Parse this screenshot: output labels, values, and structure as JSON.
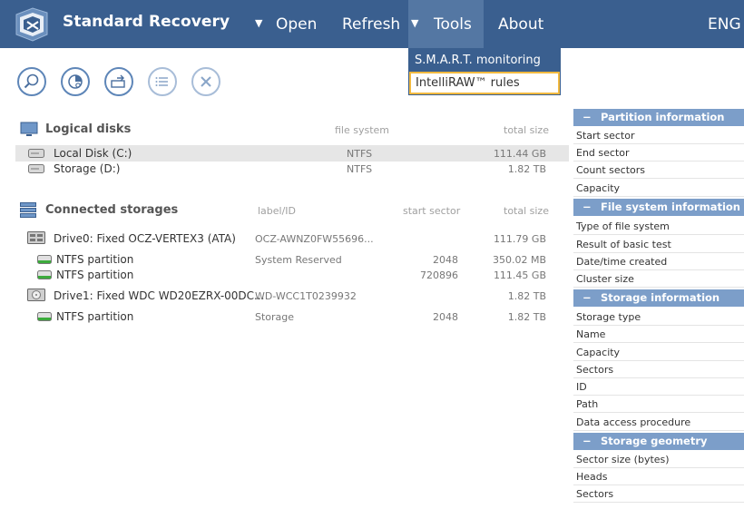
{
  "header": {
    "title": "Standard Recovery",
    "menu": {
      "open": "Open",
      "refresh": "Refresh",
      "tools": "Tools",
      "about": "About",
      "lang": "ENG"
    },
    "arrow_glyph": "▼"
  },
  "tools_menu": {
    "items": [
      "S.M.A.R.T. monitoring",
      "IntelliRAW™ rules"
    ]
  },
  "toolbar": {
    "icons": [
      "search-icon",
      "scan-icon",
      "transfer-icon",
      "list-icon",
      "close-icon"
    ]
  },
  "logical_disks": {
    "title": "Logical disks",
    "col_fs": "file system",
    "col_size": "total size",
    "rows": [
      {
        "name": "Local Disk (C:)",
        "fs": "NTFS",
        "size": "111.44 GB"
      },
      {
        "name": "Storage (D:)",
        "fs": "NTFS",
        "size": "1.82 TB"
      }
    ]
  },
  "connected_storages": {
    "title": "Connected storages",
    "col_label": "label/ID",
    "col_start": "start sector",
    "col_size": "total size",
    "drives": [
      {
        "name": "Drive0: Fixed OCZ-VERTEX3 (ATA)",
        "label": "OCZ-AWNZ0FW55696...",
        "start": "",
        "size": "111.79 GB"
      },
      {
        "name": "Drive1: Fixed WDC WD20EZRX-00DC...",
        "label": "WD-WCC1T0239932",
        "start": "",
        "size": "1.82 TB"
      }
    ],
    "partitions": [
      {
        "name": "NTFS partition",
        "label": "System Reserved",
        "start": "2048",
        "size": "350.02 MB"
      },
      {
        "name": "NTFS partition",
        "label": "",
        "start": "720896",
        "size": "111.45 GB"
      },
      {
        "name": "NTFS partition",
        "label": "Storage",
        "start": "2048",
        "size": "1.82 TB"
      }
    ]
  },
  "right_panel": {
    "dash": "−",
    "partition_info": {
      "title": "Partition information",
      "fields": [
        "Start sector",
        "End sector",
        "Count sectors",
        "Capacity"
      ]
    },
    "fs_info": {
      "title": "File system information",
      "fields": [
        "Type of file system",
        "Result of basic test",
        "Date/time created",
        "Cluster size"
      ]
    },
    "storage_info": {
      "title": "Storage information",
      "fields": [
        "Storage type",
        "Name",
        "Capacity",
        "Sectors",
        "ID",
        "Path",
        "Data access procedure"
      ]
    },
    "storage_geometry": {
      "title": "Storage geometry",
      "fields": [
        "Sector size (bytes)",
        "Heads",
        "Sectors"
      ]
    }
  },
  "colors": {
    "topbar": "#3a5f8f",
    "tools_active": "#5477a3",
    "panel_header": "#7c9ec9",
    "highlight": "#f1b940"
  }
}
